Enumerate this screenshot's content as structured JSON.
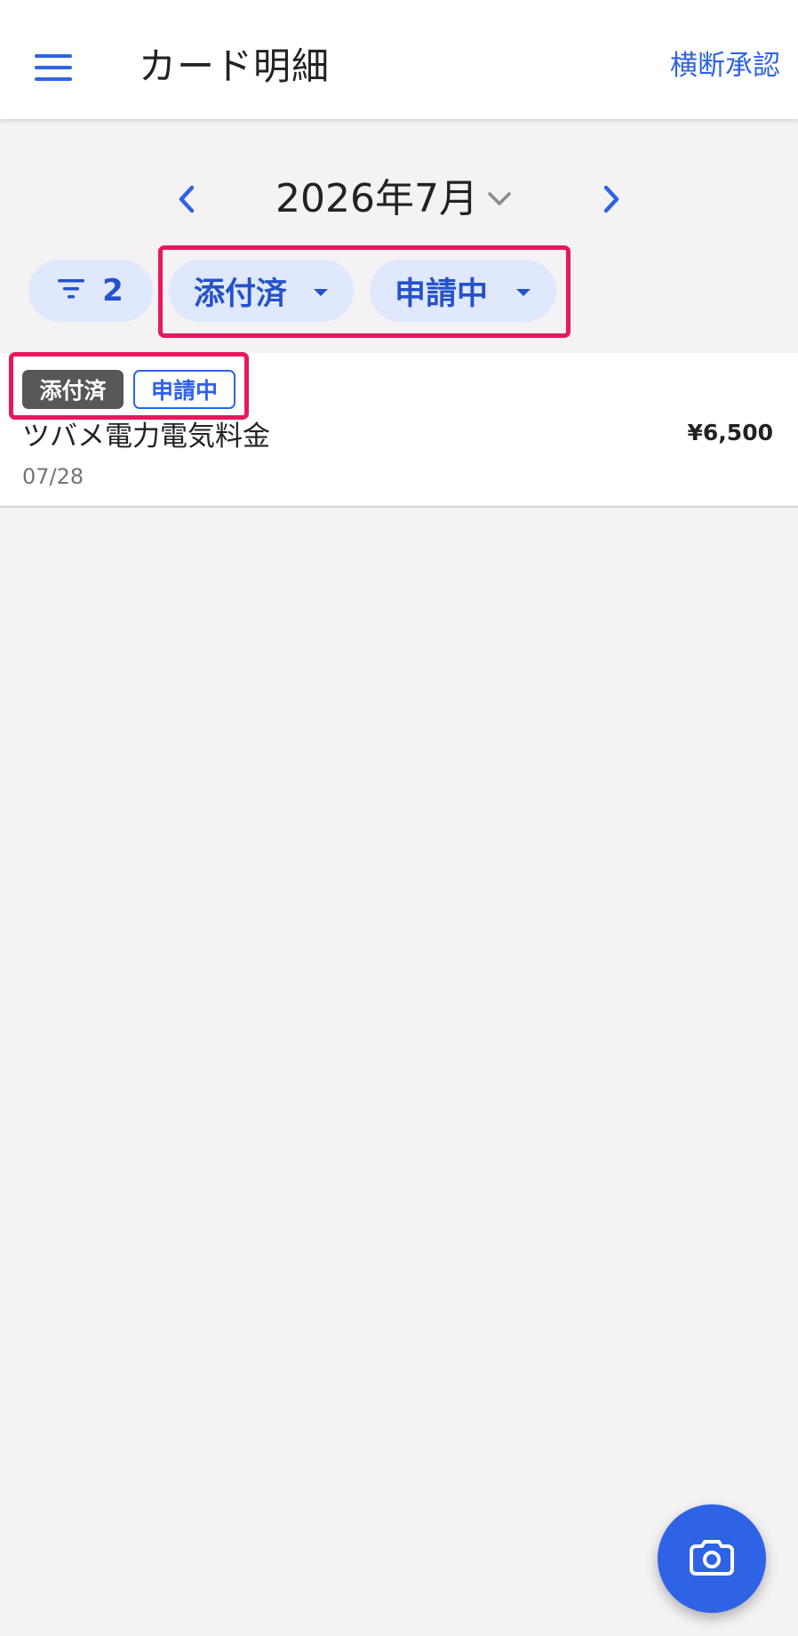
{
  "app_bar": {
    "menu_icon": "hamburger-menu-icon",
    "title": "カード明細",
    "action_label": "横断承認"
  },
  "month_nav": {
    "prev_icon": "chevron-left-icon",
    "next_icon": "chevron-right-icon",
    "month_label": "2026年7月",
    "dropdown_icon": "chevron-down-icon"
  },
  "filters": {
    "count_chip": {
      "icon": "filter-list-icon",
      "count": "2"
    },
    "attachment_chip": {
      "label": "添付済",
      "icon": "arrow-drop-down-icon"
    },
    "status_chip": {
      "label": "申請中",
      "icon": "arrow-drop-down-icon"
    }
  },
  "transactions": [
    {
      "badges": [
        "添付済",
        "申請中"
      ],
      "name": "ツバメ電力電気料金",
      "date": "07/28",
      "amount": "¥6,500"
    }
  ],
  "fab": {
    "icon": "camera-icon"
  },
  "colors": {
    "accent": "#2f63e6",
    "chip_bg": "#dfe8fd",
    "chip_text": "#2452c9",
    "highlight": "#e8175d",
    "badge_dark": "#575757",
    "background": "#f4f2f3"
  }
}
